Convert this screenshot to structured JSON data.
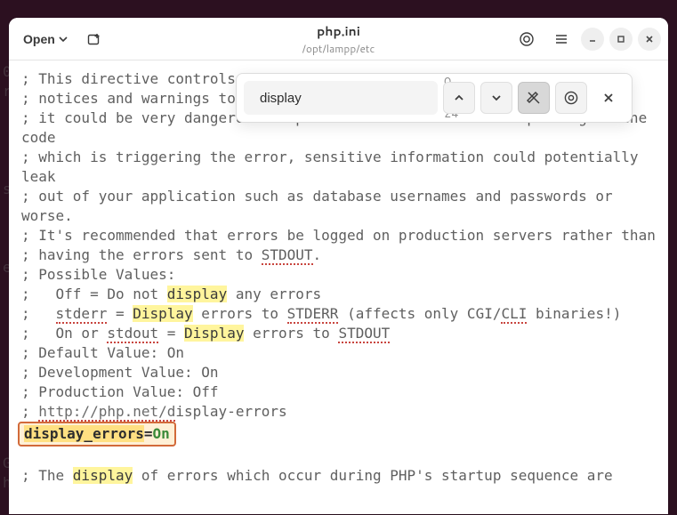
{
  "gutter": "\n\n\n0\nr\n\n\n\n\ns\n\n\n\ne\n\n\n\n\n\n\n\n\n\nG\nh\n",
  "header": {
    "open_label": "Open",
    "title": "php.ini",
    "subtitle": "/opt/lampp/etc"
  },
  "search": {
    "placeholder": "",
    "value": "display",
    "count": "0 of 24"
  },
  "editor": {
    "l1_pre": "; This directive controls ",
    "l2": "; notices and warnings too, but",
    "l3": "; it could be very dangerous in production environments. Depending on the code",
    "l4": "; which is triggering the error, sensitive information could potentially leak",
    "l5": "; out of your application such as database usernames and passwords or worse.",
    "l6": "; It's recommended that errors be logged on production servers rather than",
    "l7_pre": "; having the errors sent to ",
    "l7_stdout": "STDOUT",
    "l7_post": ".",
    "l8": "; Possible Values:",
    "l9_pre": ";   Off = Do not ",
    "l9_hl": "display",
    "l9_post": " any errors",
    "l10_pre": ";   ",
    "l10_stderr": "stderr",
    "l10_mid1": " = ",
    "l10_hl": "Display",
    "l10_mid2": " errors to ",
    "l10_stderr2": "STDERR",
    "l10_mid3": " (affects only CGI/",
    "l10_cli": "CLI",
    "l10_post": " binaries!)",
    "l11_pre": ";   On or ",
    "l11_stdout": "stdout",
    "l11_mid1": " = ",
    "l11_hl": "Display",
    "l11_mid2": " errors to ",
    "l11_stdout2": "STDOUT",
    "l12": "; Default Value: On",
    "l13": "; Development Value: On",
    "l14": "; Production Value: Off",
    "l15_pre": "; ",
    "l15_obsc": "http://php.net/d",
    "l15_post": "isplay-errors",
    "l16_key": "display_errors",
    "l16_eq": "=",
    "l16_val": "On",
    "l18_pre": "; The ",
    "l18_hl": "display",
    "l18_post": " of errors which occur during PHP's startup sequence are"
  }
}
